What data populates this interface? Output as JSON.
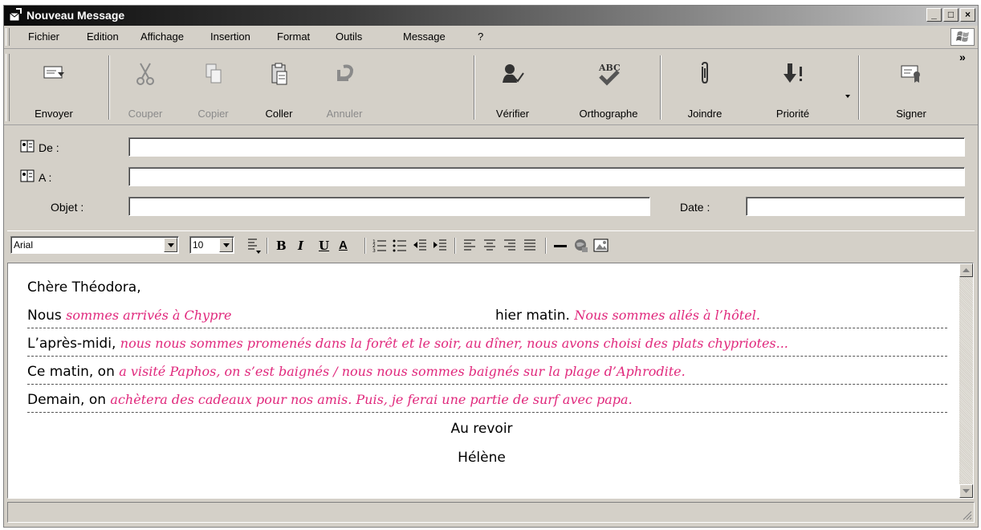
{
  "window": {
    "title": "Nouveau Message"
  },
  "menu": [
    "Fichier",
    "Edition",
    "Affichage",
    "Insertion",
    "Format",
    "Outils",
    "Message",
    "?"
  ],
  "toolbar": {
    "send": "Envoyer",
    "cut": "Couper",
    "copy": "Copier",
    "paste": "Coller",
    "undo": "Annuler",
    "check": "Vérifier",
    "spelling": "Orthographe",
    "attach": "Joindre",
    "priority": "Priorité",
    "sign": "Signer",
    "more": "»",
    "spelling_icon_text": "ABC"
  },
  "header": {
    "from_label": "De :",
    "to_label": "A :",
    "subject_label": "Objet :",
    "date_label": "Date :",
    "from_value": "",
    "to_value": "",
    "subject_value": "",
    "date_value": ""
  },
  "format": {
    "font": "Arial",
    "size": "10",
    "bold": "B",
    "italic": "I",
    "underline": "U",
    "color": "A"
  },
  "message": {
    "greeting": "Chère Théodora,",
    "lines": [
      {
        "prefix": "Nous",
        "answer": "sommes arrivés à Chypre",
        "middle": "hier matin.",
        "answer2": "Nous sommes allés à l’hôtel."
      },
      {
        "prefix": "L’après-midi,",
        "answer": "nous nous sommes promenés dans la forêt et le soir, au dîner, nous avons choisi des plats chypriotes..."
      },
      {
        "prefix": "Ce matin, on",
        "answer": "a visité Paphos, on s’est baignés / nous nous sommes baignés sur la plage d’Aphrodite."
      },
      {
        "prefix": "Demain, on",
        "answer": "achètera des cadeaux pour nos amis. Puis, je ferai une partie de surf avec papa."
      }
    ],
    "closing": "Au revoir",
    "signature": "Hélène"
  },
  "colors": {
    "answer": "#e0287c",
    "chrome": "#d4d0c8"
  }
}
